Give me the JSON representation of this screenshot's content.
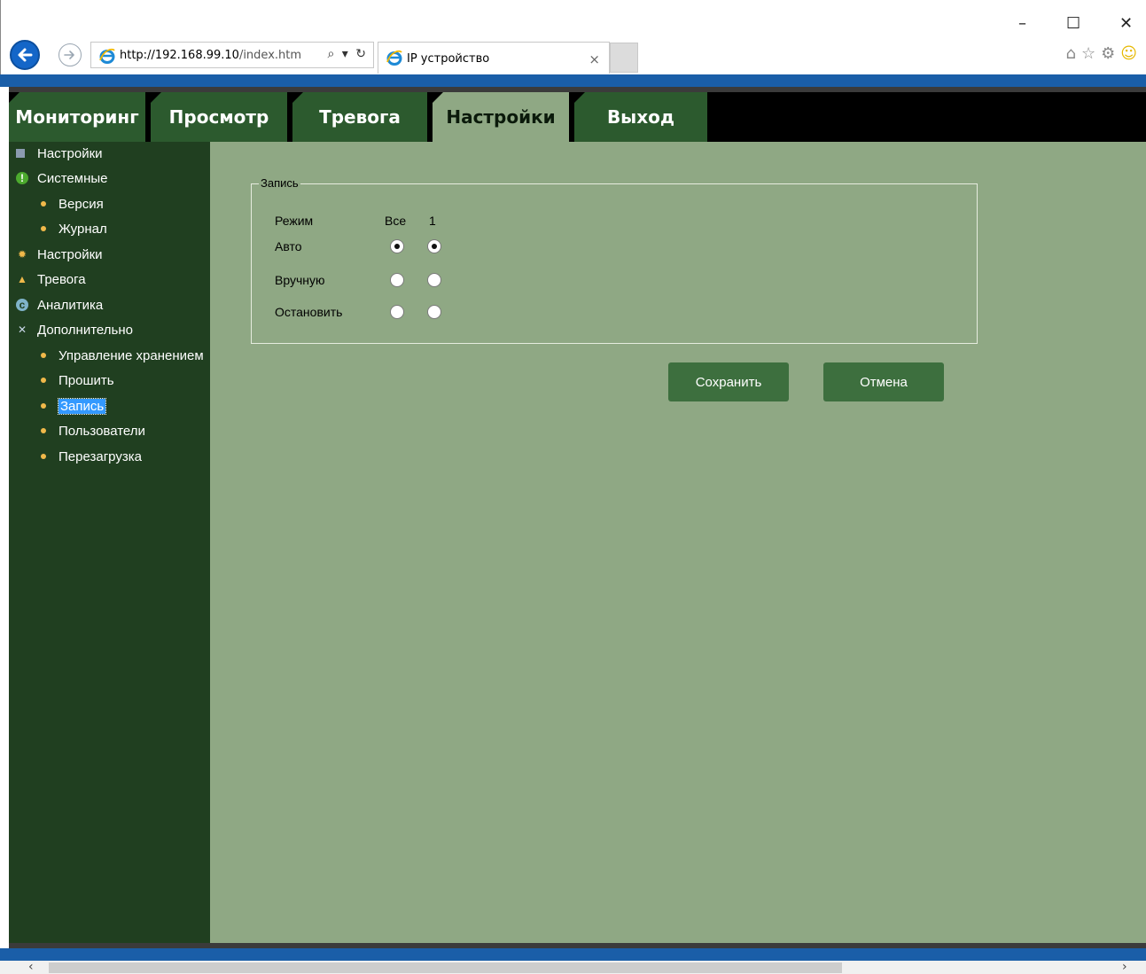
{
  "browser": {
    "url_host": "http://192.168.99.10",
    "url_path": "/index.htm",
    "url_controls": "⌕ ▾ ↻",
    "tab_title": "IP устройство",
    "tab_close": "×",
    "minimize": "–",
    "maximize": "☐",
    "close": "✕",
    "toolbar_icons": [
      "home-icon",
      "favorites-star-icon",
      "settings-gear-icon",
      "feedback-smiley-icon"
    ],
    "accent_color": "#1a5ea8"
  },
  "nav": {
    "tabs": [
      {
        "label": "Мониторинг",
        "active": false
      },
      {
        "label": "Просмотр",
        "active": false
      },
      {
        "label": "Тревога",
        "active": false
      },
      {
        "label": "Настройки",
        "active": true
      },
      {
        "label": "Выход",
        "active": false
      }
    ]
  },
  "sidebar": {
    "items": [
      {
        "label": "Настройки",
        "icon": "settings-tree-icon",
        "level": 0
      },
      {
        "label": "Системные",
        "icon": "info-icon",
        "level": 0
      },
      {
        "label": "Версия",
        "level": 1
      },
      {
        "label": "Журнал",
        "level": 1
      },
      {
        "label": "Настройки",
        "icon": "gear-icon",
        "level": 0
      },
      {
        "label": "Тревога",
        "icon": "alarm-bell-icon",
        "level": 0
      },
      {
        "label": "Аналитика",
        "icon": "analytics-icon",
        "level": 0
      },
      {
        "label": "Дополнительно",
        "icon": "tools-icon",
        "level": 0
      },
      {
        "label": "Управление хранением",
        "level": 1
      },
      {
        "label": "Прошить",
        "level": 1
      },
      {
        "label": "Запись",
        "level": 1,
        "selected": true
      },
      {
        "label": "Пользователи",
        "level": 1
      },
      {
        "label": "Перезагрузка",
        "level": 1
      }
    ]
  },
  "record": {
    "legend": "Запись",
    "header_mode": "Режим",
    "header_all": "Все",
    "header_channel": "1",
    "rows": [
      {
        "label": "Авто",
        "all_selected": true,
        "ch1_selected": true
      },
      {
        "label": "Вручную",
        "all_selected": false,
        "ch1_selected": false
      },
      {
        "label": "Остановить",
        "all_selected": false,
        "ch1_selected": false
      }
    ]
  },
  "buttons": {
    "save": "Сохранить",
    "cancel": "Отмена"
  },
  "scrollbar": {
    "left_arrow": "‹",
    "right_arrow": "›"
  },
  "colors": {
    "nav_tab": "#2c5a2e",
    "content_bg": "#8fa884",
    "sidebar_bg": "#203f20",
    "button_bg": "#3d6f3e",
    "selection": "#3399ff"
  }
}
